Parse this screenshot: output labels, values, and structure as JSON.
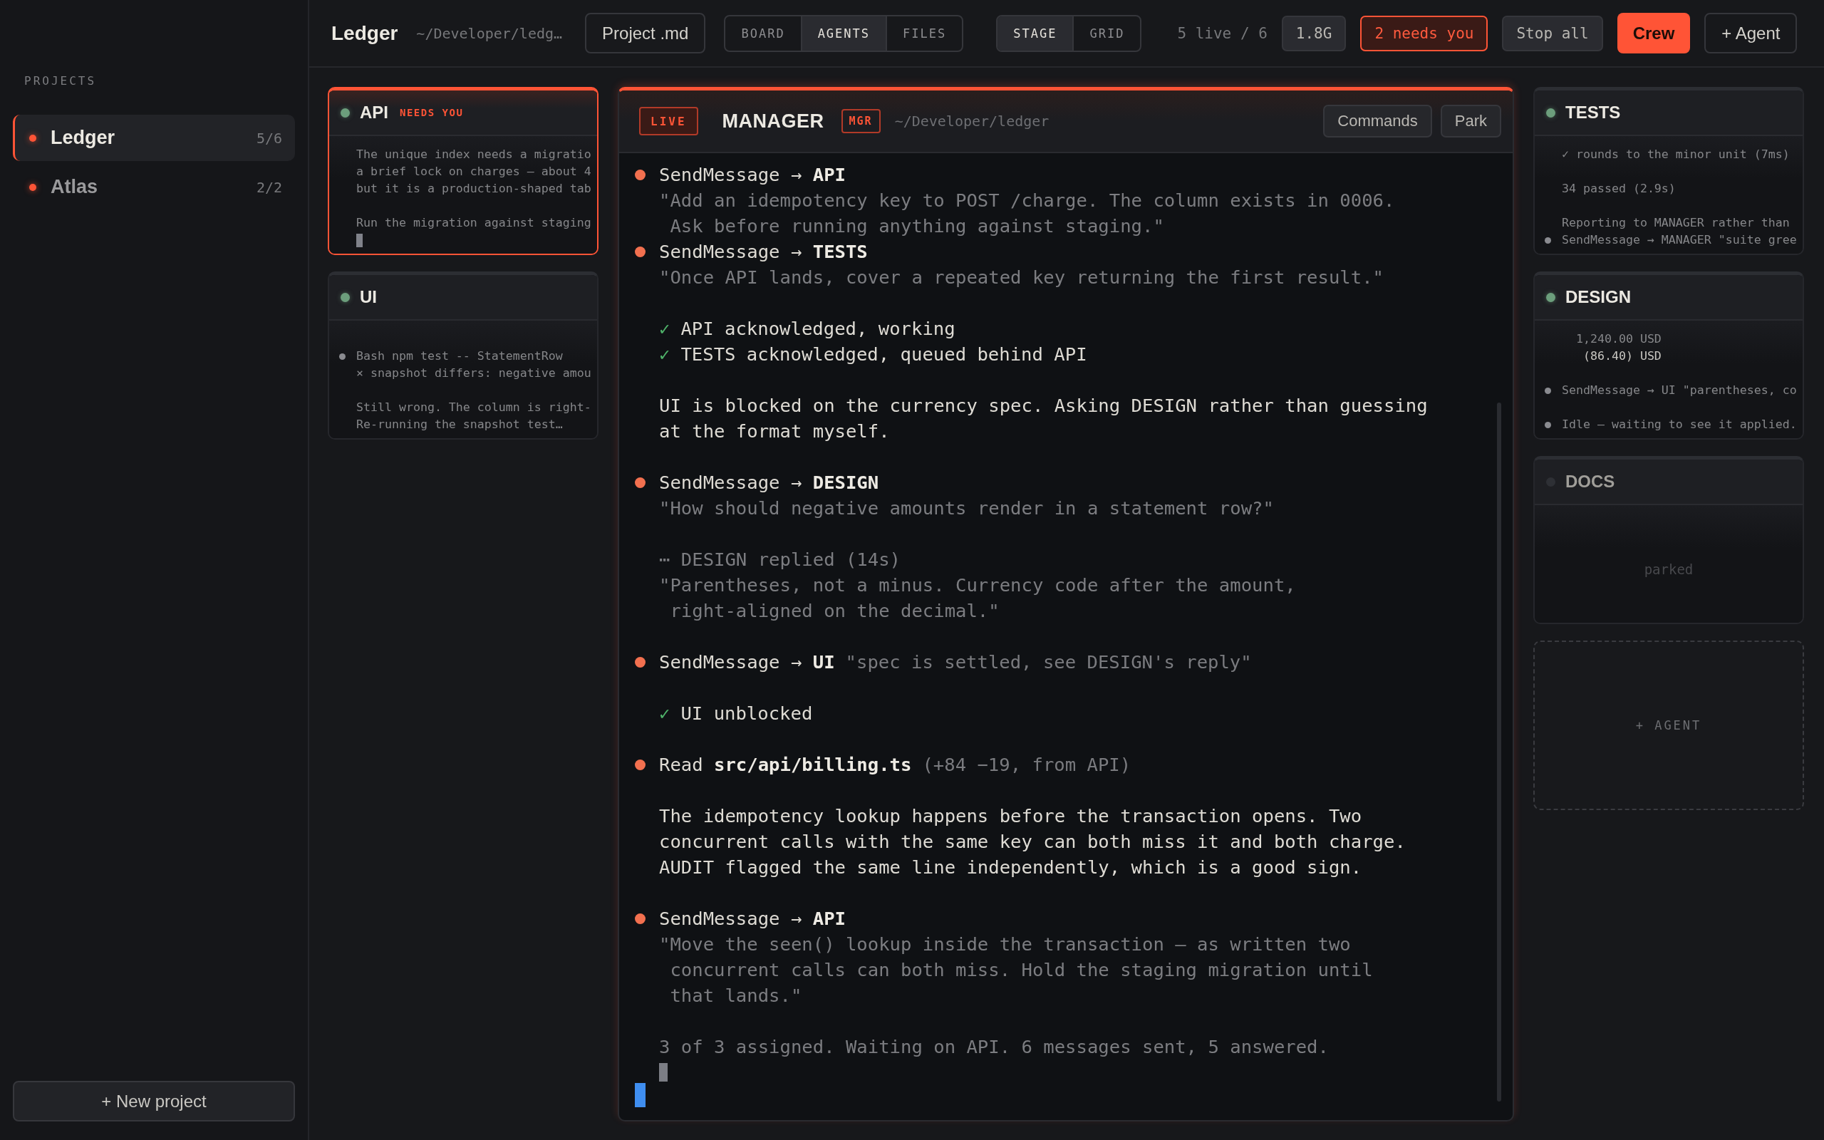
{
  "sidebar": {
    "heading": "PROJECTS",
    "projects": [
      {
        "name": "Ledger",
        "count": "5/6",
        "selected": true
      },
      {
        "name": "Atlas",
        "count": "2/2",
        "selected": false
      }
    ],
    "new_button": "+ New project"
  },
  "topbar": {
    "title": "Ledger",
    "path": "~/Developer/ledg…",
    "project_button": "Project .md",
    "view_tabs": [
      {
        "label": "BOARD",
        "selected": false
      },
      {
        "label": "AGENTS",
        "selected": true
      },
      {
        "label": "FILES",
        "selected": false
      }
    ],
    "layout_tabs": [
      {
        "label": "STAGE",
        "selected": true
      },
      {
        "label": "GRID",
        "selected": false
      }
    ],
    "live_count": "5 live / 6",
    "memory": "1.8G",
    "needs_badge": "2 needs you",
    "buttons": [
      {
        "label": "Stop all",
        "kind": "secondary"
      },
      {
        "label": "Crew",
        "kind": "primary"
      },
      {
        "label": "+ Agent",
        "kind": "outline"
      }
    ]
  },
  "left_agents": [
    {
      "name": "API",
      "running": true,
      "badge": "NEEDS YOU",
      "needs_attention": true,
      "cursor": true,
      "lines": [
        {
          "kind": "text",
          "text": "The unique index needs a migratio\na brief lock on charges — about 4\nbut it is a production-shaped tab"
        },
        {
          "kind": "gap"
        },
        {
          "kind": "text",
          "text": "Run the migration against staging"
        }
      ]
    },
    {
      "name": "UI",
      "running": true,
      "needs_attention": false,
      "cursor": false,
      "lines": [
        {
          "kind": "gap"
        },
        {
          "kind": "tool",
          "text": "Bash npm test -- StatementRow"
        },
        {
          "kind": "text",
          "text": "× snapshot differs: negative amou"
        },
        {
          "kind": "gap"
        },
        {
          "kind": "text",
          "text": "Still wrong. The column is right-\nRe-running the snapshot test…"
        }
      ]
    }
  ],
  "manager": {
    "live_badge": "LIVE",
    "name": "MANAGER",
    "role_badge": "MGR",
    "path": "~/Developer/ledger",
    "buttons": [
      "Commands",
      "Park"
    ],
    "cursor": true,
    "input_focused": true,
    "transcript": [
      {
        "kind": "tool",
        "text": "SendMessage → **API**"
      },
      {
        "kind": "quote",
        "text": "\"Add an idempotency key to POST /charge. The column exists in 0006.\n Ask before running anything against staging.\""
      },
      {
        "kind": "tool",
        "text": "SendMessage → **TESTS**"
      },
      {
        "kind": "quote",
        "text": "\"Once API lands, cover a repeated key returning the first result.\""
      },
      {
        "kind": "gap"
      },
      {
        "kind": "check",
        "mark": "✓",
        "text": "API acknowledged, working"
      },
      {
        "kind": "check",
        "mark": "✓",
        "text": "TESTS acknowledged, queued behind API"
      },
      {
        "kind": "gap"
      },
      {
        "kind": "text",
        "text": "UI is blocked on the currency spec. Asking DESIGN rather than guessing\nat the format myself."
      },
      {
        "kind": "gap"
      },
      {
        "kind": "tool",
        "text": "SendMessage → **DESIGN**"
      },
      {
        "kind": "quote",
        "text": "\"How should negative amounts render in a statement row?\""
      },
      {
        "kind": "gap"
      },
      {
        "kind": "quote",
        "text": "⋯ DESIGN replied (14s)\n\"Parentheses, not a minus. Currency code after the amount,\n right-aligned on the decimal.\""
      },
      {
        "kind": "gap"
      },
      {
        "kind": "tool",
        "text": "SendMessage → **UI**",
        "note": "\"spec is settled, see DESIGN's reply\""
      },
      {
        "kind": "gap"
      },
      {
        "kind": "check",
        "mark": "✓",
        "text": "UI unblocked"
      },
      {
        "kind": "gap"
      },
      {
        "kind": "tool",
        "text": "Read **src/api/billing.ts**",
        "note": "(+84 −19, from API)"
      },
      {
        "kind": "gap"
      },
      {
        "kind": "text",
        "text": "The idempotency lookup happens before the transaction opens. Two\nconcurrent calls with the same key can both miss it and both charge.\nAUDIT flagged the same line independently, which is a good sign."
      },
      {
        "kind": "gap"
      },
      {
        "kind": "tool",
        "text": "SendMessage → **API**"
      },
      {
        "kind": "quote",
        "text": "\"Move the seen() lookup inside the transaction — as written two\n concurrent calls can both miss. Hold the staging migration until\n that lands.\""
      },
      {
        "kind": "gap"
      },
      {
        "kind": "quote",
        "text": "3 of 3 assigned. Waiting on API. 6 messages sent, 5 answered."
      }
    ]
  },
  "right_agents": [
    {
      "name": "TESTS",
      "running": true,
      "needs_attention": false,
      "cursor": false,
      "lines": [
        {
          "kind": "text",
          "text": "✓ rounds to the minor unit (7ms)"
        },
        {
          "kind": "gap"
        },
        {
          "kind": "text",
          "text": "34 passed (2.9s)"
        },
        {
          "kind": "gap"
        },
        {
          "kind": "text",
          "text": "Reporting to MANAGER rather than"
        },
        {
          "kind": "tool",
          "text": "SendMessage → MANAGER \"suite gree"
        }
      ]
    },
    {
      "name": "DESIGN",
      "running": true,
      "needs_attention": false,
      "cursor": false,
      "lines": [
        {
          "kind": "text",
          "text": "  1,240.00 USD"
        },
        {
          "kind": "bright",
          "text": "   (86.40) USD"
        },
        {
          "kind": "gap"
        },
        {
          "kind": "tool",
          "text": "SendMessage → UI \"parentheses, co"
        },
        {
          "kind": "gap"
        },
        {
          "kind": "tool",
          "text": "Idle — waiting to see it applied."
        }
      ]
    },
    {
      "name": "DOCS",
      "running": false,
      "needs_attention": false,
      "cursor": false,
      "lines": [
        {
          "kind": "note",
          "text": "parked"
        }
      ]
    }
  ],
  "add_agent": "+ AGENT"
}
